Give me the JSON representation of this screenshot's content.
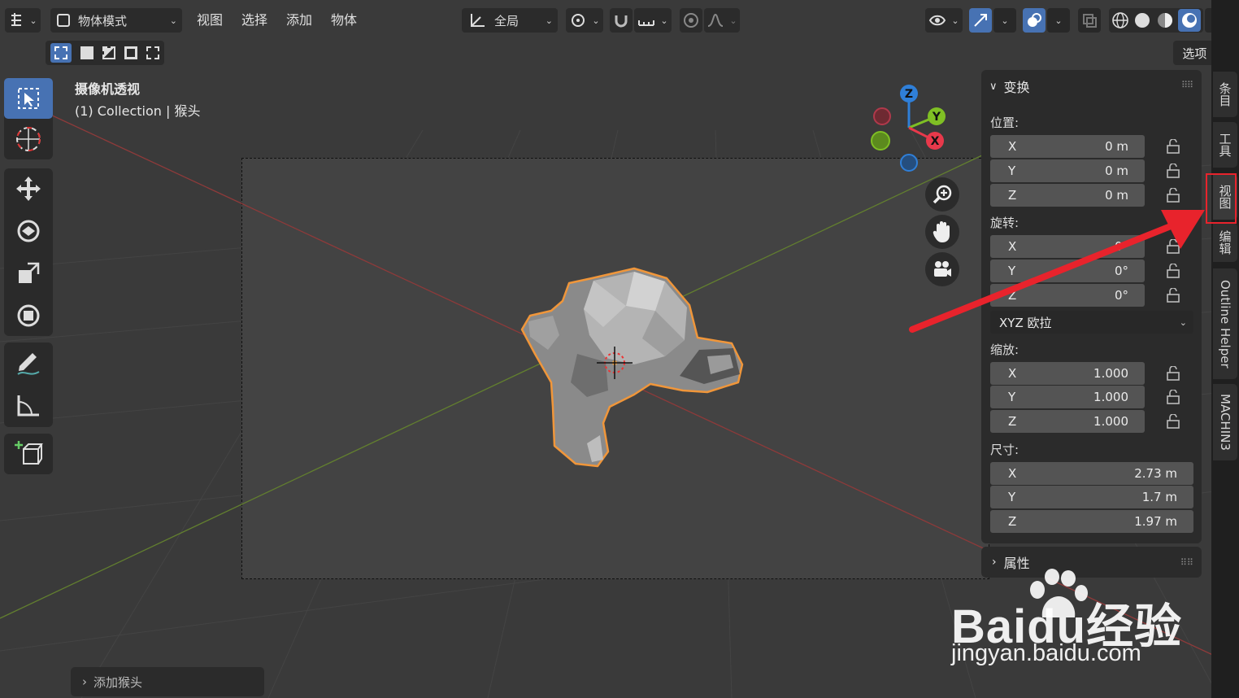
{
  "header": {
    "mode_label": "物体模式",
    "menus": [
      "视图",
      "选择",
      "添加",
      "物体"
    ],
    "transform_orientation": "全局",
    "options_label": "选项"
  },
  "viewport": {
    "view_name": "摄像机透视",
    "collection_info": "(1) Collection | 猴头",
    "gizmo_axes": {
      "z": "Z",
      "y": "Y",
      "x": "X"
    },
    "last_operator": "添加猴头"
  },
  "npanel": {
    "transform_title": "变换",
    "location_label": "位置:",
    "location": [
      {
        "axis": "X",
        "value": "0 m"
      },
      {
        "axis": "Y",
        "value": "0 m"
      },
      {
        "axis": "Z",
        "value": "0 m"
      }
    ],
    "rotation_label": "旋转:",
    "rotation": [
      {
        "axis": "X",
        "value": "0°"
      },
      {
        "axis": "Y",
        "value": "0°"
      },
      {
        "axis": "Z",
        "value": "0°"
      }
    ],
    "rotation_mode": "XYZ 欧拉",
    "scale_label": "缩放:",
    "scale": [
      {
        "axis": "X",
        "value": "1.000"
      },
      {
        "axis": "Y",
        "value": "1.000"
      },
      {
        "axis": "Z",
        "value": "1.000"
      }
    ],
    "dimensions_label": "尺寸:",
    "dimensions": [
      {
        "axis": "X",
        "value": "2.73 m"
      },
      {
        "axis": "Y",
        "value": "1.7 m"
      },
      {
        "axis": "Z",
        "value": "1.97 m"
      }
    ],
    "properties_title": "属性"
  },
  "tabs": [
    "条目",
    "工具",
    "视图",
    "编辑",
    "Outline Helper",
    "MACHIN3"
  ],
  "watermark": {
    "brand": "Baidu经验",
    "url": "jingyan.baidu.com"
  },
  "colors": {
    "accent": "#4772b3",
    "selection": "#f0963a",
    "annotation": "#e8232c",
    "x_axis": "#e8394b",
    "y_axis": "#7fbf24",
    "z_axis": "#2f7fd8"
  }
}
